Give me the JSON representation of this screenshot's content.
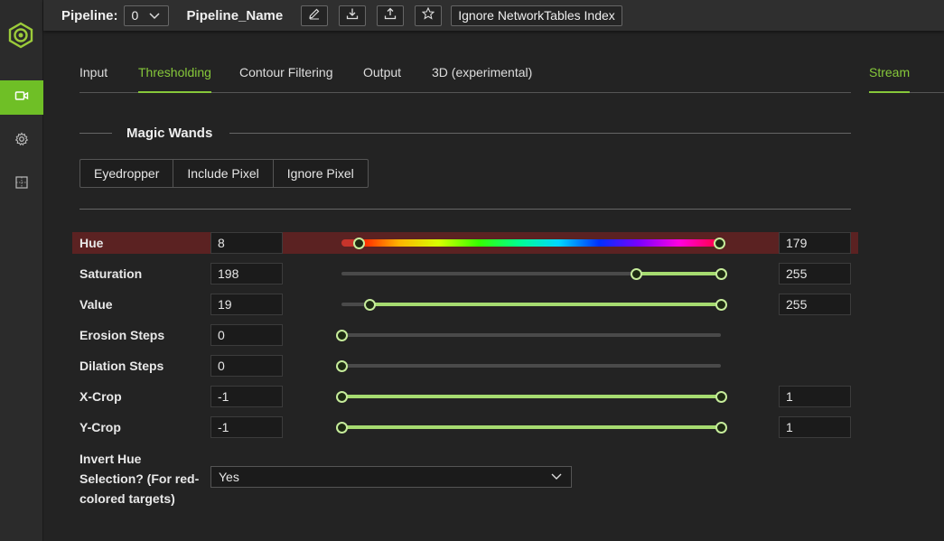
{
  "topbar": {
    "pipeline_label": "Pipeline:",
    "pipeline_index": "0",
    "pipeline_name": "Pipeline_Name",
    "ignore_nt_label": "Ignore NetworkTables Index",
    "icons": [
      "pencil-icon",
      "download-icon",
      "upload-icon",
      "star-icon"
    ]
  },
  "rail": {
    "icons": [
      "logo-icon",
      "camera-icon",
      "gear-icon",
      "dashboard-icon"
    ],
    "active": "camera-icon",
    "accent": "#6fbf26"
  },
  "tabs": [
    {
      "label": "Input",
      "active": false
    },
    {
      "label": "Thresholding",
      "active": true
    },
    {
      "label": "Contour Filtering",
      "active": false
    },
    {
      "label": "Output",
      "active": false
    },
    {
      "label": "3D (experimental)",
      "active": false
    }
  ],
  "stream_tab": {
    "label": "Stream",
    "active": true
  },
  "magic_wands": {
    "title": "Magic Wands",
    "buttons": [
      "Eyedropper",
      "Include Pixel",
      "Ignore Pixel"
    ]
  },
  "rows": [
    {
      "label": "Hue",
      "low": "8",
      "high": "179",
      "min": 0,
      "max": 180,
      "lowValue": 8,
      "highValue": 179,
      "highlight": true,
      "hue": true
    },
    {
      "label": "Saturation",
      "low": "198",
      "high": "255",
      "min": 0,
      "max": 255,
      "lowValue": 198,
      "highValue": 255
    },
    {
      "label": "Value",
      "low": "19",
      "high": "255",
      "min": 0,
      "max": 255,
      "lowValue": 19,
      "highValue": 255
    },
    {
      "label": "Erosion Steps",
      "low": "0",
      "min": 0,
      "max": 5,
      "lowValue": 0,
      "single": true
    },
    {
      "label": "Dilation Steps",
      "low": "0",
      "min": 0,
      "max": 5,
      "lowValue": 0,
      "single": true
    },
    {
      "label": "X-Crop",
      "low": "-1",
      "high": "1",
      "min": -1,
      "max": 1,
      "lowValue": -1,
      "highValue": 1
    },
    {
      "label": "Y-Crop",
      "low": "-1",
      "high": "1",
      "min": -1,
      "max": 1,
      "lowValue": -1,
      "highValue": 1
    }
  ],
  "invert_hue": {
    "label": "Invert Hue Selection? (For red-colored targets)",
    "value": "Yes"
  },
  "colors": {
    "accent": "#86c83a",
    "slider_fill": "#a6db70",
    "highlight_row": "#5b2222"
  }
}
